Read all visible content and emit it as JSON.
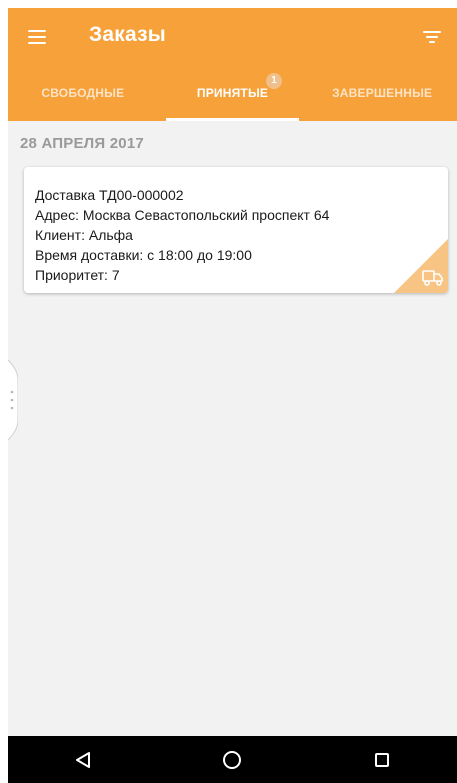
{
  "appbar": {
    "title": "Заказы",
    "menu_icon": "hamburger-menu-icon",
    "filter_icon": "filter-icon",
    "color": "#f7a13a"
  },
  "tabs": [
    {
      "label": "СВОБОДНЫЕ",
      "active": false
    },
    {
      "label": "ПРИНЯТЫЕ",
      "active": true,
      "badge": "1"
    },
    {
      "label": "ЗАВЕРШЕННЫЕ",
      "active": false
    }
  ],
  "date_header": "28 АПРЕЛЯ 2017",
  "orders": [
    {
      "title": "Доставка ТД00-000002",
      "address": "Адрес: Москва Севастопольский проспект 64",
      "client": "Клиент: Альфа",
      "time": "Время доставки: с 18:00 до 19:00",
      "priority": "Приоритет: 7",
      "icon": "delivery-truck-icon"
    }
  ],
  "navbar": {
    "back_icon": "back-triangle-icon",
    "home_icon": "home-circle-icon",
    "recents_icon": "recents-square-icon"
  }
}
